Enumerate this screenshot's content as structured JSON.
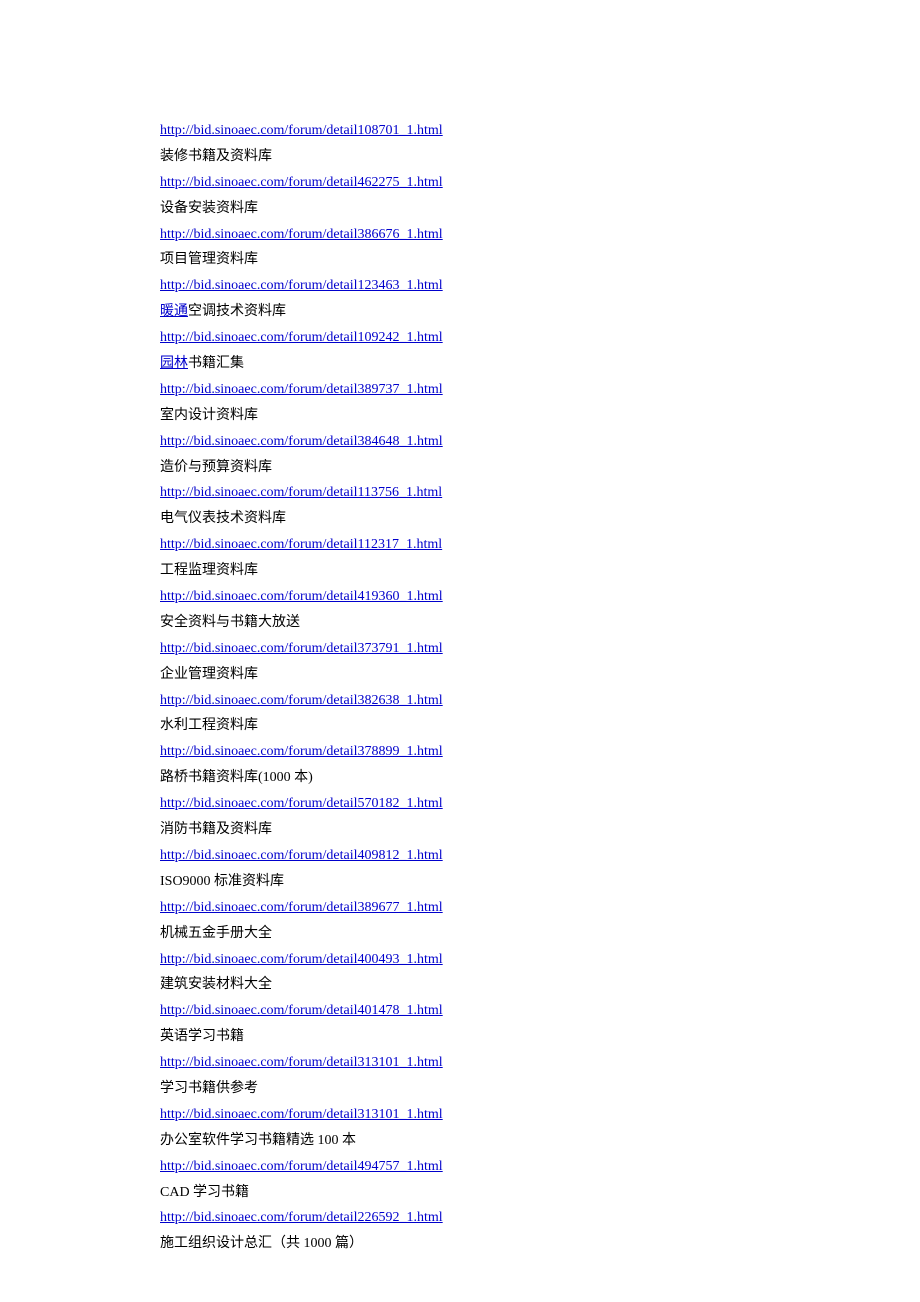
{
  "entries": [
    {
      "url": "http://bid.sinoaec.com/forum/detail108701_1.html",
      "label": "装修书籍及资料库"
    },
    {
      "url": "http://bid.sinoaec.com/forum/detail462275_1.html",
      "label": "设备安装资料库"
    },
    {
      "url": "http://bid.sinoaec.com/forum/detail386676_1.html",
      "label": "项目管理资料库"
    },
    {
      "url": "http://bid.sinoaec.com/forum/detail123463_1.html",
      "prefixLink": "暖通",
      "suffix": "空调技术资料库"
    },
    {
      "url": "http://bid.sinoaec.com/forum/detail109242_1.html",
      "prefixLink": "园林",
      "suffix": "书籍汇集"
    },
    {
      "url": "http://bid.sinoaec.com/forum/detail389737_1.html",
      "label": "室内设计资料库"
    },
    {
      "url": "http://bid.sinoaec.com/forum/detail384648_1.html",
      "label": "造价与预算资料库"
    },
    {
      "url": "http://bid.sinoaec.com/forum/detail113756_1.html",
      "label": "电气仪表技术资料库"
    },
    {
      "url": "http://bid.sinoaec.com/forum/detail112317_1.html",
      "label": "工程监理资料库"
    },
    {
      "url": "http://bid.sinoaec.com/forum/detail419360_1.html",
      "label": "安全资料与书籍大放送"
    },
    {
      "url": "http://bid.sinoaec.com/forum/detail373791_1.html",
      "label": "企业管理资料库"
    },
    {
      "url": "http://bid.sinoaec.com/forum/detail382638_1.html",
      "label": "水利工程资料库"
    },
    {
      "url": "http://bid.sinoaec.com/forum/detail378899_1.html",
      "label": "路桥书籍资料库(1000 本)"
    },
    {
      "url": "http://bid.sinoaec.com/forum/detail570182_1.html",
      "label": "消防书籍及资料库"
    },
    {
      "url": "http://bid.sinoaec.com/forum/detail409812_1.html",
      "label": "ISO9000 标准资料库"
    },
    {
      "url": "http://bid.sinoaec.com/forum/detail389677_1.html",
      "label": "机械五金手册大全"
    },
    {
      "url": "http://bid.sinoaec.com/forum/detail400493_1.html",
      "label": "建筑安装材料大全"
    },
    {
      "url": "http://bid.sinoaec.com/forum/detail401478_1.html",
      "label": "英语学习书籍"
    },
    {
      "url": "http://bid.sinoaec.com/forum/detail313101_1.html",
      "label": "学习书籍供参考"
    },
    {
      "url": "http://bid.sinoaec.com/forum/detail313101_1.html",
      "label": "办公室软件学习书籍精选 100 本"
    },
    {
      "url": "http://bid.sinoaec.com/forum/detail494757_1.html",
      "label": "CAD 学习书籍"
    },
    {
      "url": "http://bid.sinoaec.com/forum/detail226592_1.html",
      "label": "施工组织设计总汇（共 1000 篇）"
    }
  ]
}
